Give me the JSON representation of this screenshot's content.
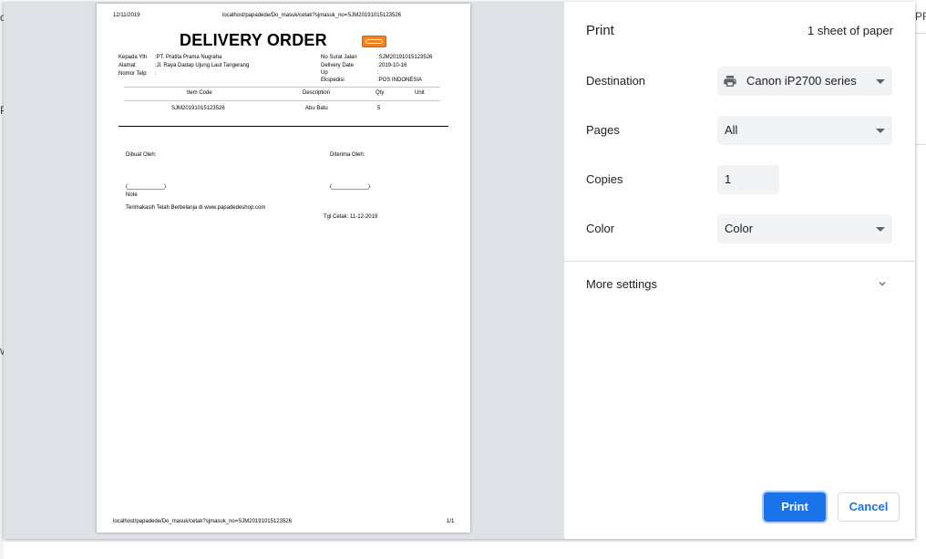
{
  "background": {
    "left_fragments": [
      "c",
      "P",
      "W"
    ],
    "right_fragment": "PR"
  },
  "paper": {
    "header_date": "12/11/2019",
    "header_url": "localhost/papadede/Do_masuk/cetak?sjmasuk_no=SJM20191015123526",
    "title": "DELIVERY ORDER",
    "left_info": [
      {
        "label": "Kepada Yth",
        "value": ":PT. Pratita Prama Nugraha"
      },
      {
        "label": "Alamat",
        "value": ":Jl. Raya Dadap Ujung Laut Tangerang"
      },
      {
        "label": "Nomor Telp",
        "value": ":"
      }
    ],
    "right_info": [
      {
        "label": "No Surat Jalan",
        "value": ":SJM20191015123526"
      },
      {
        "label": "Delivery Date",
        "value": ":2019-10-16"
      },
      {
        "label": "Up",
        "value": ":"
      },
      {
        "label": "Ekspedisi",
        "value": ":POS INDONESIA"
      }
    ],
    "table": {
      "headers": [
        "Item Code",
        "Description",
        "Qty",
        "Unit"
      ],
      "rows": [
        {
          "item_code": "SJM20191015123526",
          "description": "Abu Batu",
          "qty": "5",
          "unit": ""
        }
      ]
    },
    "made_by_label": "Dibuat Oleh:",
    "received_by_label": "Diterima Oleh:",
    "signature_left": "(____________)",
    "signature_right": "(____________)",
    "note_label": "Note",
    "thanks": "Terimakasih Telah Berbelanja di www.papadedeshop.com",
    "print_date": "Tgl Cetak: 11-12-2019",
    "footer_url": "localhost/papadede/Do_masuk/cetak?sjmasuk_no=SJM20191015123526",
    "footer_page": "1/1"
  },
  "settings": {
    "title": "Print",
    "sheets": "1 sheet of paper",
    "destination_label": "Destination",
    "destination_value": "Canon iP2700 series",
    "pages_label": "Pages",
    "pages_value": "All",
    "copies_label": "Copies",
    "copies_value": "1",
    "color_label": "Color",
    "color_value": "Color",
    "more_settings": "More settings",
    "print_button": "Print",
    "cancel_button": "Cancel"
  },
  "colors": {
    "accent": "#1a73e8",
    "preview_bg": "#dee1e6",
    "field_bg": "#f1f3f4",
    "logo": "#f58220"
  },
  "icons": {
    "printer": "printer-icon",
    "dropdown": "caret-down-icon",
    "expand": "chevron-down-icon"
  }
}
